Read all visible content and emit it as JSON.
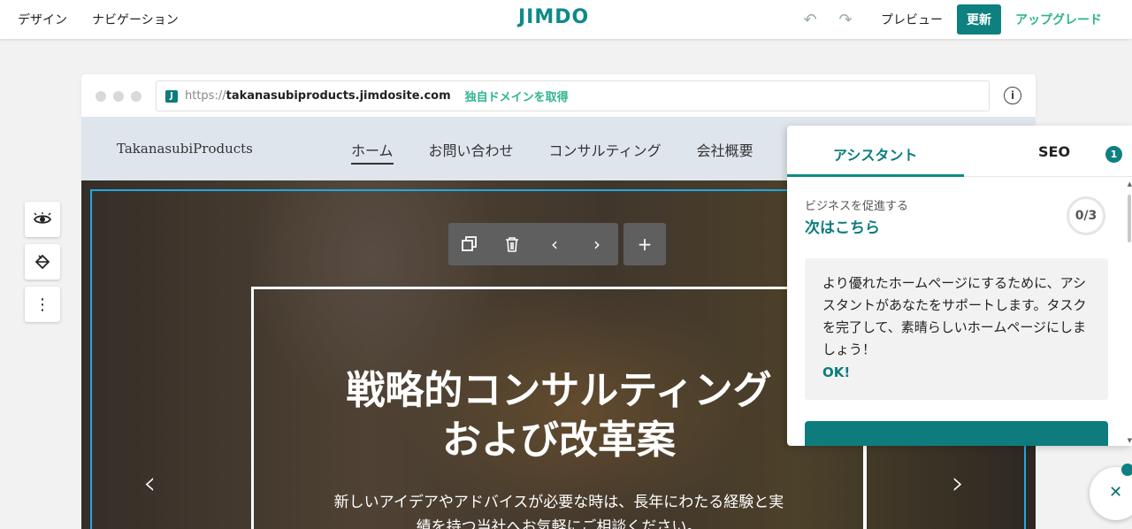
{
  "topbar": {
    "design": "デザイン",
    "navigation": "ナビゲーション",
    "logo": "JIMDO",
    "preview": "プレビュー",
    "update": "更新",
    "upgrade": "アップグレード"
  },
  "browser": {
    "proto": "https://",
    "host": "takanasubiproducts.jimdosite.com",
    "get_domain": "独自ドメインを取得"
  },
  "site": {
    "name": "TakanasubiProducts",
    "nav": [
      "ホーム",
      "お問い合わせ",
      "コンサルティング",
      "会社概要"
    ]
  },
  "hero": {
    "title_line1": "戦略的コンサルティング",
    "title_line2": "および改革案",
    "subtitle_line1": "新しいアイデアやアドバイスが必要な時は、長年にわたる経験と実",
    "subtitle_line2": "績を持つ当社へお気軽にご相談ください。"
  },
  "panel": {
    "tab_assistant": "アシスタント",
    "tab_seo": "SEO",
    "seo_badge": "1",
    "sub": "ビジネスを促進する",
    "title": "次はこちら",
    "progress": "0/3",
    "card_text": "より優れたホームページにするために、アシスタントがあなたをサポートします。タスクを完了して、素晴らしいホームページにしましょう！",
    "ok": "OK!"
  },
  "colors": {
    "accent": "#0e8080",
    "green": "#2fb58f",
    "select": "#22a7e0"
  }
}
